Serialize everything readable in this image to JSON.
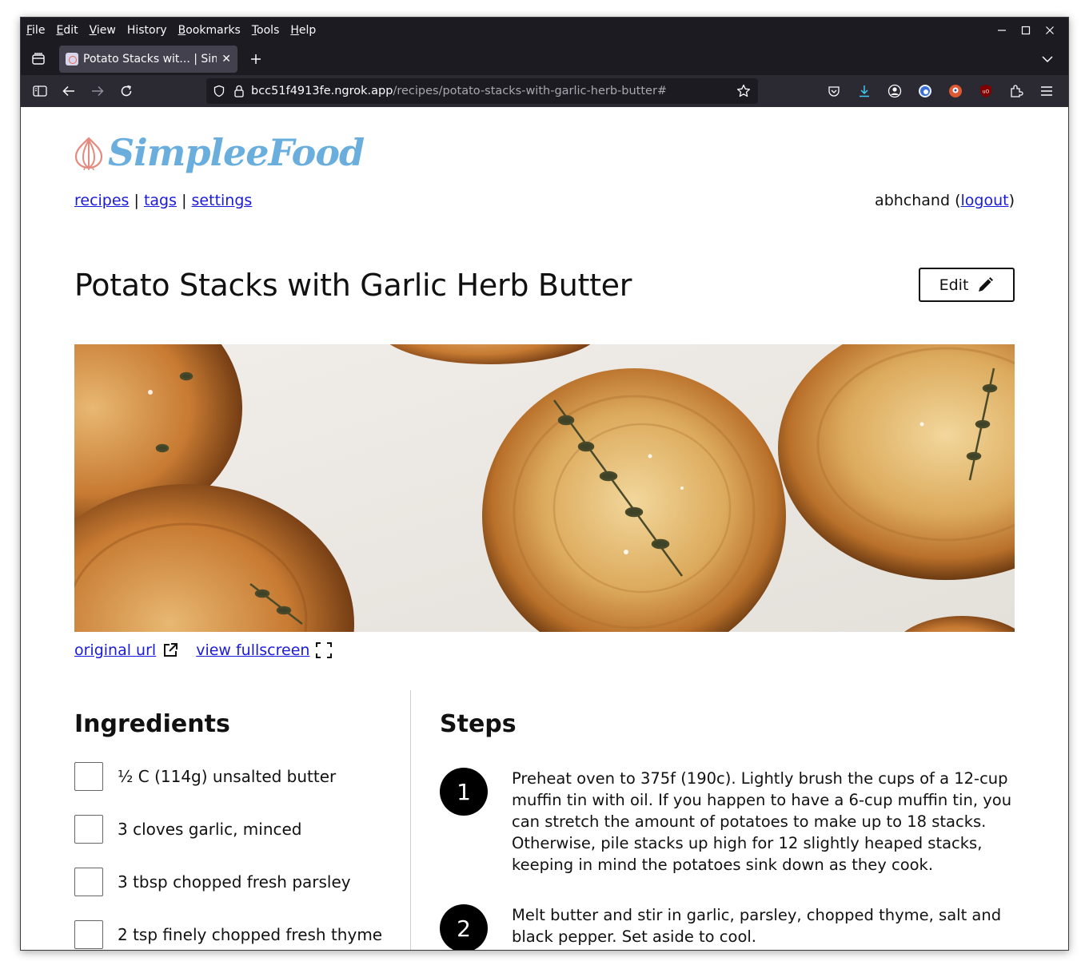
{
  "menubar": {
    "items": [
      {
        "underline": "F",
        "rest": "ile"
      },
      {
        "underline": "E",
        "rest": "dit"
      },
      {
        "underline": "V",
        "rest": "iew"
      },
      {
        "underline": "",
        "rest": "History",
        "u2": "s"
      },
      {
        "underline": "B",
        "rest": "ookmarks"
      },
      {
        "underline": "T",
        "rest": "ools"
      },
      {
        "underline": "H",
        "rest": "elp"
      }
    ],
    "labels": [
      "File",
      "Edit",
      "View",
      "History",
      "Bookmarks",
      "Tools",
      "Help"
    ]
  },
  "tab": {
    "title": "Potato Stacks wit... | Simp"
  },
  "urlbar": {
    "host": "bcc51f4913fe.ngrok.app",
    "path": "/recipes/potato-stacks-with-garlic-herb-butter#"
  },
  "site": {
    "logo_text": "SimpleeFood",
    "nav": {
      "recipes": "recipes",
      "tags": "tags",
      "settings": "settings",
      "sep": "|"
    },
    "user": {
      "name": "abhchand",
      "logout": "logout",
      "open": " (",
      "close": ")"
    }
  },
  "recipe": {
    "title": "Potato Stacks with Garlic Herb Butter",
    "edit_label": "Edit",
    "original_url_label": "original url",
    "fullscreen_label": "view fullscreen",
    "ingredients_heading": "Ingredients",
    "ingredients": [
      "½ C (114g) unsalted butter",
      "3 cloves garlic, minced",
      "3 tbsp chopped fresh parsley",
      "2 tsp finely chopped fresh thyme"
    ],
    "steps_heading": "Steps",
    "steps": [
      {
        "number": "1",
        "text": "Preheat oven to 375f (190c). Lightly brush the cups of a 12-cup muffin tin with oil. If you happen to have a 6-cup muffin tin, you can stretch the amount of potatoes to make up to 18 stacks. Otherwise, pile stacks up high for 12 slightly heaped stacks, keeping in mind the potatoes sink down as they cook."
      },
      {
        "number": "2",
        "text": "Melt butter and stir in garlic, parsley, chopped thyme, salt and black pepper. Set aside to cool."
      }
    ]
  },
  "colors": {
    "logo_blue": "#6aaede",
    "logo_onion": "#e48a80",
    "link": "#1a1adb",
    "chrome_dark": "#1c1b22",
    "chrome_nav": "#2b2a33"
  }
}
